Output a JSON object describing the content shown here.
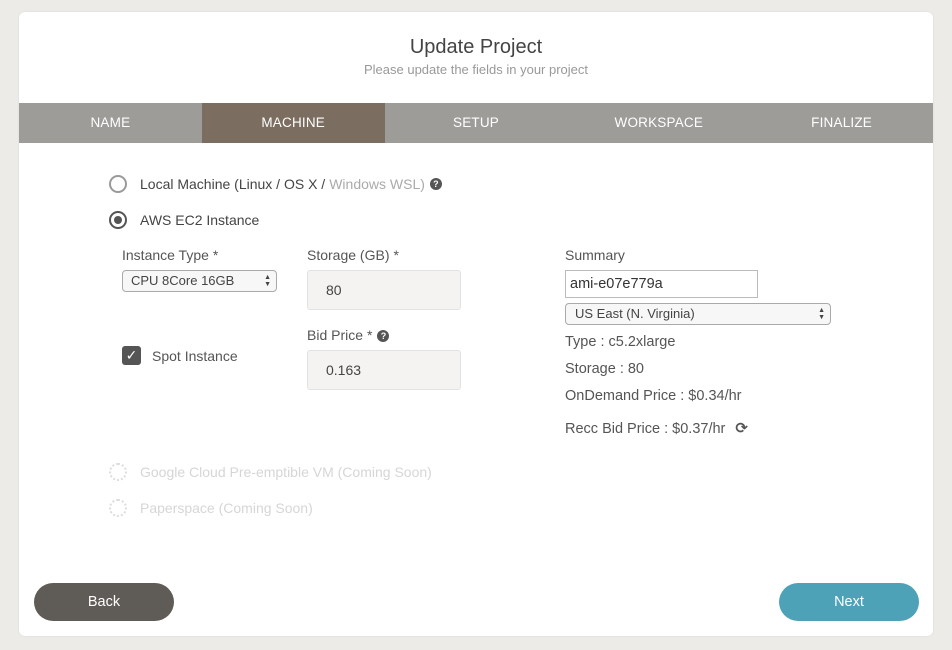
{
  "header": {
    "title": "Update Project",
    "subtitle": "Please update the fields in your project"
  },
  "tabs": [
    {
      "label": "NAME",
      "active": false
    },
    {
      "label": "MACHINE",
      "active": true
    },
    {
      "label": "SETUP",
      "active": false
    },
    {
      "label": "WORKSPACE",
      "active": false
    },
    {
      "label": "FINALIZE",
      "active": false
    }
  ],
  "machine_options": {
    "local": {
      "label": "Local Machine (Linux / OS X /",
      "muted_label": "Windows WSL)",
      "selected": false
    },
    "aws": {
      "label": "AWS EC2 Instance",
      "selected": true
    },
    "google": {
      "label": "Google Cloud Pre-emptible VM (Coming Soon)",
      "disabled": true
    },
    "paperspace": {
      "label": "Paperspace (Coming Soon)",
      "disabled": true
    }
  },
  "form": {
    "instance_type_label": "Instance Type",
    "instance_type_value": "CPU 8Core 16GB",
    "storage_label": "Storage (GB)",
    "storage_value": "80",
    "bid_price_label": "Bid Price",
    "bid_price_value": "0.163",
    "required_marker": "*",
    "spot_instance_label": "Spot Instance",
    "spot_instance_checked": true
  },
  "summary": {
    "title": "Summary",
    "ami_value": "ami-e07e779a",
    "region_value": "US East (N. Virginia)",
    "type_line": "Type : c5.2xlarge",
    "storage_line": "Storage : 80",
    "ondemand_line": "OnDemand Price : $0.34/hr",
    "recc_bid_line": "Recc Bid Price : $0.37/hr"
  },
  "footer": {
    "back_label": "Back",
    "next_label": "Next"
  },
  "colors": {
    "tab_bar": "#9d9c99",
    "tab_active": "#7b6e60",
    "back_button": "#5f5b56",
    "next_button": "#4da2b8"
  }
}
